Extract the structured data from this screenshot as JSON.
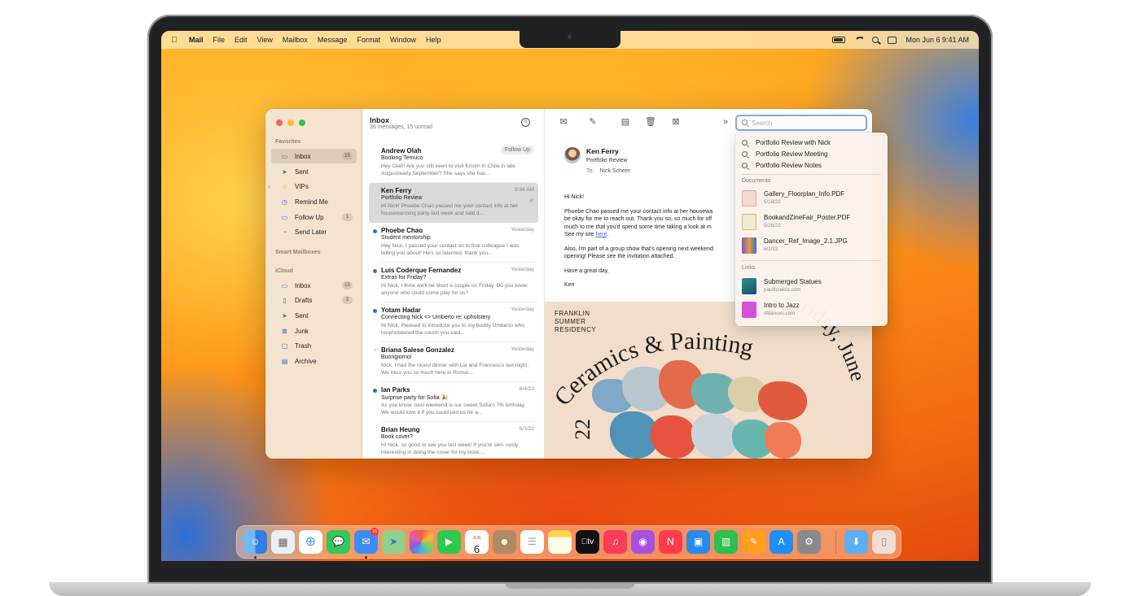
{
  "menubar": {
    "apple": "",
    "items": [
      "Mail",
      "File",
      "Edit",
      "View",
      "Mailbox",
      "Message",
      "Format",
      "Window",
      "Help"
    ],
    "datetime": "Mon Jun 6  9:41 AM",
    "status_icons": [
      "battery-icon",
      "wifi-icon",
      "spotlight-icon",
      "control-center-icon"
    ]
  },
  "sidebar": {
    "favorites_heading": "Favorites",
    "smart_heading": "Smart Mailboxes",
    "icloud_heading": "iCloud",
    "favorites": [
      {
        "label": "Inbox",
        "count": "15",
        "icon": "tray-icon"
      },
      {
        "label": "Sent",
        "count": "",
        "icon": "paperplane-icon"
      },
      {
        "label": "VIPs",
        "count": "",
        "icon": "star-icon"
      },
      {
        "label": "Remind Me",
        "count": "",
        "icon": "clock-icon"
      },
      {
        "label": "Follow Up",
        "count": "1",
        "icon": "follow-up-icon"
      },
      {
        "label": "Send Later",
        "count": "",
        "icon": "send-later-icon"
      }
    ],
    "icloud": [
      {
        "label": "Inbox",
        "count": "15",
        "icon": "tray-icon"
      },
      {
        "label": "Drafts",
        "count": "2",
        "icon": "doc-icon"
      },
      {
        "label": "Sent",
        "count": "",
        "icon": "paperplane-icon"
      },
      {
        "label": "Junk",
        "count": "",
        "icon": "junk-icon"
      },
      {
        "label": "Trash",
        "count": "",
        "icon": "trash-icon"
      },
      {
        "label": "Archive",
        "count": "",
        "icon": "archive-icon"
      }
    ]
  },
  "list": {
    "title": "Inbox",
    "subtitle": "36 messages, 15 unread",
    "messages": [
      {
        "from": "Andrew Olah",
        "date": "",
        "tag": "Follow Up",
        "subject": "Booking Temuco",
        "preview": "Hey Olah! Are you still keen to visit Kristin in Chile in late August/early September? She says she has..."
      },
      {
        "from": "Ken Ferry",
        "date": "9:34 AM",
        "tag": "",
        "subject": "Portfolio Review",
        "preview": "Hi Nick! Phoebe Chao passed me your contact info at her housewarming party last week and said it..."
      },
      {
        "from": "Phoebe Chao",
        "date": "Yesterday",
        "tag": "",
        "subject": "Student mentorship",
        "preview": "Hey Nick, I passed your contact on to that colleague I was telling you about! He's so talented, thank you..."
      },
      {
        "from": "Luis Coderque Fernandez",
        "date": "Yesterday",
        "tag": "",
        "subject": "Extras for Friday?",
        "preview": "Hi Nick, I think we'll be short a couple on Friday. Do you know anyone who could come play for us?"
      },
      {
        "from": "Yotam Hadar",
        "date": "Yesterday",
        "tag": "",
        "subject": "Connecting Nick <> Umberto re: upholstery",
        "preview": "Hi Nick, Pleased to introduce you to my buddy Umberto who reupholstered the couch you said..."
      },
      {
        "from": "Briana Salese Gonzalez",
        "date": "Yesterday",
        "tag": "",
        "subject": "Buongiorno!",
        "preview": "Nick, I had the nicest dinner with Lia and Francesco last night. We miss you so much here in Roma!..."
      },
      {
        "from": "Ian Parks",
        "date": "6/4/22",
        "tag": "",
        "subject": "Surprise party for Sofia 🎉",
        "preview": "As you know, next weekend is our sweet Sofia's 7th birthday. We would love it if you could join us for a..."
      },
      {
        "from": "Brian Heung",
        "date": "6/3/22",
        "tag": "",
        "subject": "Book cover?",
        "preview": "Hi Nick, so good to see you last week! If you're seri- ously interesting in doing the cover for my book,..."
      }
    ]
  },
  "reader": {
    "from": "Ken Ferry",
    "subject": "Portfolio Review",
    "to_label": "To:",
    "to": "Nick Scheer",
    "greeting": "Hi Nick!",
    "p1_l1": "Phoebe Chao passed me your contact info at her housewa",
    "p1_l2": "be okay for me to reach out. Thank you so, so much for off",
    "p1_l3": "much to me that you'd spend some time taking a look at m",
    "p1_l4a": "See my site ",
    "p1_link": "here",
    "p1_l4b": ".",
    "p2_l1": "Also, I'm part of a group show that's opening next weekend",
    "p2_l2": "opening! Please see the invitation attached.",
    "closing": "Have a great day,",
    "sign": "Ken",
    "poster_label_1": "FRANKLIN",
    "poster_label_2": "SUMMER",
    "poster_label_3": "RESIDENCY",
    "poster_arc": "Ceramics & Painting",
    "poster_date": "Friday, June",
    "poster_year": "22"
  },
  "toolbar": {
    "search_placeholder": "Search",
    "icons": [
      "envelope-icon",
      "compose-icon",
      "archive-icon",
      "trash-icon",
      "junk-icon",
      "more-icon"
    ]
  },
  "search": {
    "suggestions": [
      "Portfolio Review with Nick",
      "Portfolio Review Meeting",
      "Portfolio Review Notes"
    ],
    "documents_heading": "Documents",
    "documents": [
      {
        "name": "Gallery_Floorplan_Info.PDF",
        "date": "5/18/22",
        "color": "#e9a6a0"
      },
      {
        "name": "BookandZineFair_Poster.PDF",
        "date": "5/26/22",
        "color": "#cfc06a"
      },
      {
        "name": "Dancer_Ref_Image_2.1.JPG",
        "date": "6/1/22",
        "color": "#7b56c9"
      }
    ],
    "links_heading": "Links",
    "links": [
      {
        "name": "Submerged Statues",
        "url": "pacificrelics.com",
        "color": "#2f8f8a"
      },
      {
        "name": "Intro to Jazz",
        "url": "sfdances.com",
        "color": "#d84fd0"
      }
    ]
  },
  "dock": {
    "calendar_day": "6",
    "calendar_month": "JUN",
    "mail_badge": "15",
    "tv_label": "tv",
    "apps": [
      {
        "name": "finder-icon",
        "color": "#3d8ff0"
      },
      {
        "name": "launchpad-icon",
        "color": "#eceff3"
      },
      {
        "name": "safari-icon",
        "color": "#3a9af3"
      },
      {
        "name": "messages-icon",
        "color": "#34c759"
      },
      {
        "name": "mail-icon",
        "color": "#3b8df5"
      },
      {
        "name": "maps-icon",
        "color": "#6fc36b"
      },
      {
        "name": "photos-icon",
        "color": "#ffffff"
      },
      {
        "name": "facetime-icon",
        "color": "#2fc84f"
      },
      {
        "name": "calendar-icon",
        "color": "#ffffff"
      },
      {
        "name": "contacts-icon",
        "color": "#b08a63"
      },
      {
        "name": "reminders-icon",
        "color": "#ffffff"
      },
      {
        "name": "notes-icon",
        "color": "#ffd84a"
      },
      {
        "name": "tv-icon",
        "color": "#111111"
      },
      {
        "name": "music-icon",
        "color": "#fb3b57"
      },
      {
        "name": "podcasts-icon",
        "color": "#a94fe0"
      },
      {
        "name": "news-icon",
        "color": "#ff3b4e"
      },
      {
        "name": "keynote-icon",
        "color": "#2b8ae8"
      },
      {
        "name": "numbers-icon",
        "color": "#2fbf4f"
      },
      {
        "name": "pages-icon",
        "color": "#ff9f1a"
      },
      {
        "name": "app-store-icon",
        "color": "#1f8ef5"
      },
      {
        "name": "system-settings-icon",
        "color": "#8a8a8e"
      },
      {
        "name": "downloads-folder-icon",
        "color": "#5ab0f0"
      },
      {
        "name": "trash-icon",
        "color": "#e8e8ea"
      }
    ]
  }
}
